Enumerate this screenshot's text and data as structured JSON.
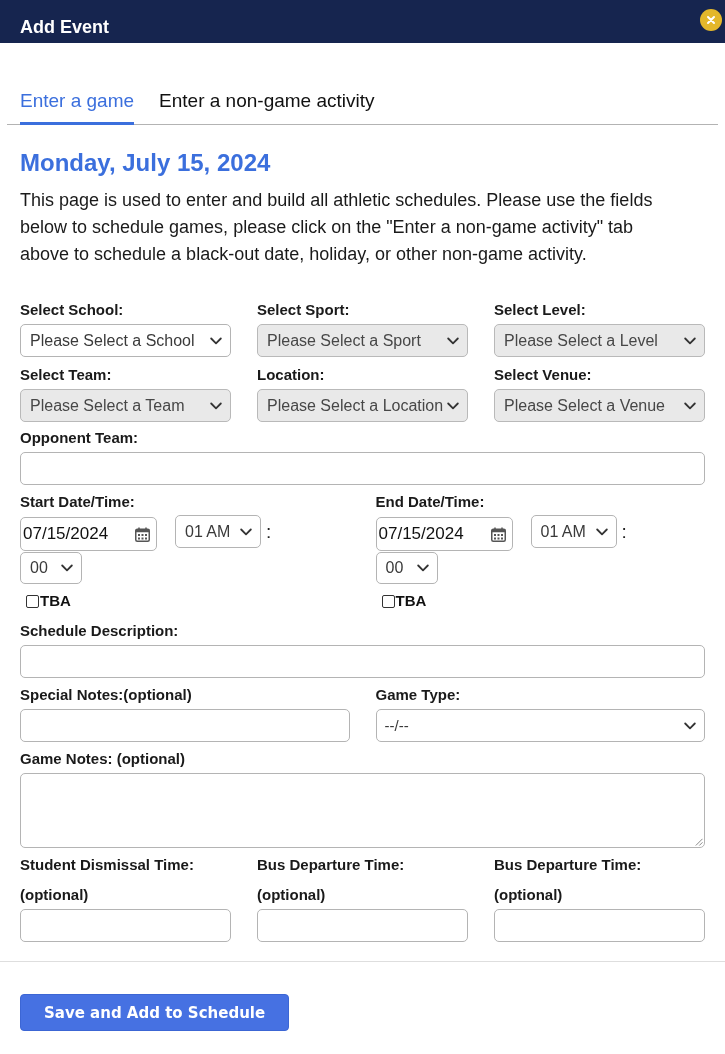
{
  "dialog": {
    "title": "Add Event"
  },
  "tabs": [
    {
      "label": "Enter a game",
      "selected": true
    },
    {
      "label": "Enter a non-game activity",
      "selected": false
    }
  ],
  "form": {
    "date_heading": "Monday, July 15, 2024",
    "intro": "This page is used to enter and build all athletic schedules. Please use the fields below to schedule games, please click on the \"Enter a non-game activity\" tab above to schedule a black-out date, holiday, or other non-game activity.",
    "selectors": [
      {
        "label": "Select School:",
        "value": "Please Select a School",
        "disabled": false
      },
      {
        "label": "Select Sport:",
        "value": "Please Select a Sport",
        "disabled": true
      },
      {
        "label": "Select Level:",
        "value": "Please Select a Level",
        "disabled": true
      },
      {
        "label": "Select Team:",
        "value": "Please Select a Team",
        "disabled": true
      },
      {
        "label": "Location:",
        "value": "Please Select a Location",
        "disabled": true
      },
      {
        "label": "Select Venue:",
        "value": "Please Select a Venue",
        "disabled": true
      }
    ],
    "opponent_team": {
      "label": "Opponent Team:"
    },
    "date_times": [
      {
        "label": "Start Date/Time:",
        "date": "07/15/2024",
        "hour": "01 AM",
        "separator": ":",
        "minute": "00",
        "tba": {
          "label": "TBA",
          "checked": false
        }
      },
      {
        "label": "End Date/Time:",
        "date": "07/15/2024",
        "hour": "01 AM",
        "separator": ":",
        "minute": "00",
        "tba": {
          "label": "TBA",
          "checked": false
        }
      }
    ],
    "schedule_description": {
      "label": "Schedule Description:"
    },
    "special_notes": {
      "label": "Special Notes:(optional)"
    },
    "game_type": {
      "label": "Game Type:",
      "value": "--/--"
    },
    "game_notes": {
      "label": "Game Notes: (optional)"
    },
    "times": [
      {
        "label": "Student Dismissal Time:",
        "note": "(optional)"
      },
      {
        "label": "Bus Departure Time:",
        "note": "(optional)"
      },
      {
        "label": "Bus Departure Time:",
        "note": "(optional)"
      }
    ],
    "save_button": {
      "label": "Save and Add to Schedule"
    }
  }
}
